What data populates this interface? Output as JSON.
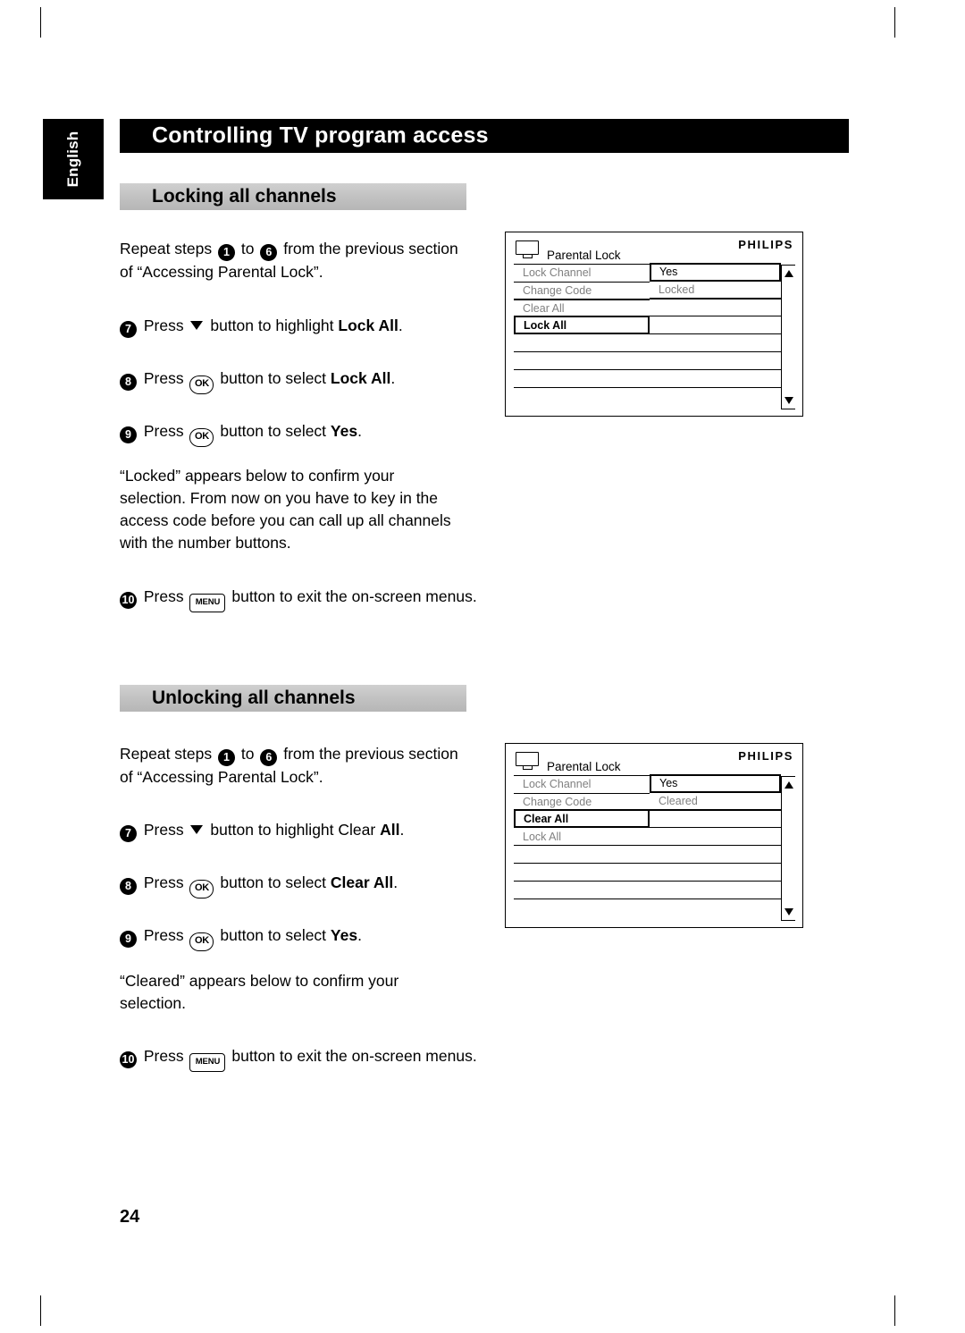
{
  "page": {
    "language_tab": "English",
    "chapter_title": "Controlling TV program access",
    "page_number": "24"
  },
  "sections": [
    {
      "heading": "Locking all channels",
      "intro": {
        "prefix": "Repeat steps",
        "from": "1",
        "mid": "to",
        "to": "6",
        "suffix": "from the previous section of “Accessing Parental Lock”."
      },
      "steps": [
        {
          "num": "7",
          "text_before": "Press",
          "key": "▼",
          "key_type": "arrow",
          "text_after_plain": "button to highlight ",
          "text_after_bold": "Lock All",
          "text_end": "."
        },
        {
          "num": "8",
          "text_before": "Press",
          "key": "OK",
          "key_type": "ok",
          "text_after_plain": "button to select ",
          "text_after_bold": "Lock All",
          "text_end": "."
        },
        {
          "num": "9",
          "text_before": "Press",
          "key": "OK",
          "key_type": "ok",
          "text_after_plain": "button to select ",
          "text_after_bold": "Yes",
          "text_end": "."
        }
      ],
      "note": "“Locked” appears below to confirm your selection. From now on you have to key in the access code before you can call up all channels with the number buttons.",
      "exit_step": {
        "num": "10",
        "text_before": "Press",
        "key": "MENU",
        "key_type": "menu",
        "text_after": "button to exit the on-screen menus."
      },
      "osd": {
        "logo": "PHILIPS",
        "title": "Parental Lock",
        "left_rows": [
          {
            "label": "Lock Channel",
            "state": "gray"
          },
          {
            "label": "Change Code",
            "state": "gray"
          },
          {
            "label": "Clear All",
            "state": "gray"
          },
          {
            "label": "Lock All",
            "state": "highlight"
          },
          {
            "label": "",
            "state": "blank"
          },
          {
            "label": "",
            "state": "blank"
          },
          {
            "label": "",
            "state": "blank"
          }
        ],
        "right_rows": [
          {
            "label": "Yes",
            "state": "highlight"
          },
          {
            "label": "Locked",
            "state": "gray"
          },
          {
            "label": "",
            "state": "blank"
          },
          {
            "label": "",
            "state": "blank"
          },
          {
            "label": "",
            "state": "blank"
          },
          {
            "label": "",
            "state": "blank"
          },
          {
            "label": "",
            "state": "blank"
          }
        ]
      }
    },
    {
      "heading": "Unlocking all channels",
      "intro": {
        "prefix": "Repeat steps",
        "from": "1",
        "mid": "to",
        "to": "6",
        "suffix": "from the previous section of “Accessing Parental Lock”."
      },
      "steps": [
        {
          "num": "7",
          "text_before": "Press",
          "key": "▼",
          "key_type": "arrow",
          "text_after_plain": "button to highlight Clear ",
          "text_after_bold": "All",
          "text_end": "."
        },
        {
          "num": "8",
          "text_before": "Press",
          "key": "OK",
          "key_type": "ok",
          "text_after_plain": "button to select ",
          "text_after_bold": "Clear All",
          "text_end": "."
        },
        {
          "num": "9",
          "text_before": "Press",
          "key": "OK",
          "key_type": "ok",
          "text_after_plain": "button to select ",
          "text_after_bold": "Yes",
          "text_end": "."
        }
      ],
      "note": "“Cleared” appears below to confirm your selection.",
      "exit_step": {
        "num": "10",
        "text_before": "Press",
        "key": "MENU",
        "key_type": "menu",
        "text_after": "button to exit the on-screen menus."
      },
      "osd": {
        "logo": "PHILIPS",
        "title": "Parental Lock",
        "left_rows": [
          {
            "label": "Lock Channel",
            "state": "gray"
          },
          {
            "label": "Change Code",
            "state": "gray"
          },
          {
            "label": "Clear All",
            "state": "highlight"
          },
          {
            "label": "Lock All",
            "state": "gray"
          },
          {
            "label": "",
            "state": "blank"
          },
          {
            "label": "",
            "state": "blank"
          },
          {
            "label": "",
            "state": "blank"
          }
        ],
        "right_rows": [
          {
            "label": "Yes",
            "state": "highlight"
          },
          {
            "label": "Cleared",
            "state": "gray"
          },
          {
            "label": "",
            "state": "blank"
          },
          {
            "label": "",
            "state": "blank"
          },
          {
            "label": "",
            "state": "blank"
          },
          {
            "label": "",
            "state": "blank"
          },
          {
            "label": "",
            "state": "blank"
          }
        ]
      }
    }
  ]
}
